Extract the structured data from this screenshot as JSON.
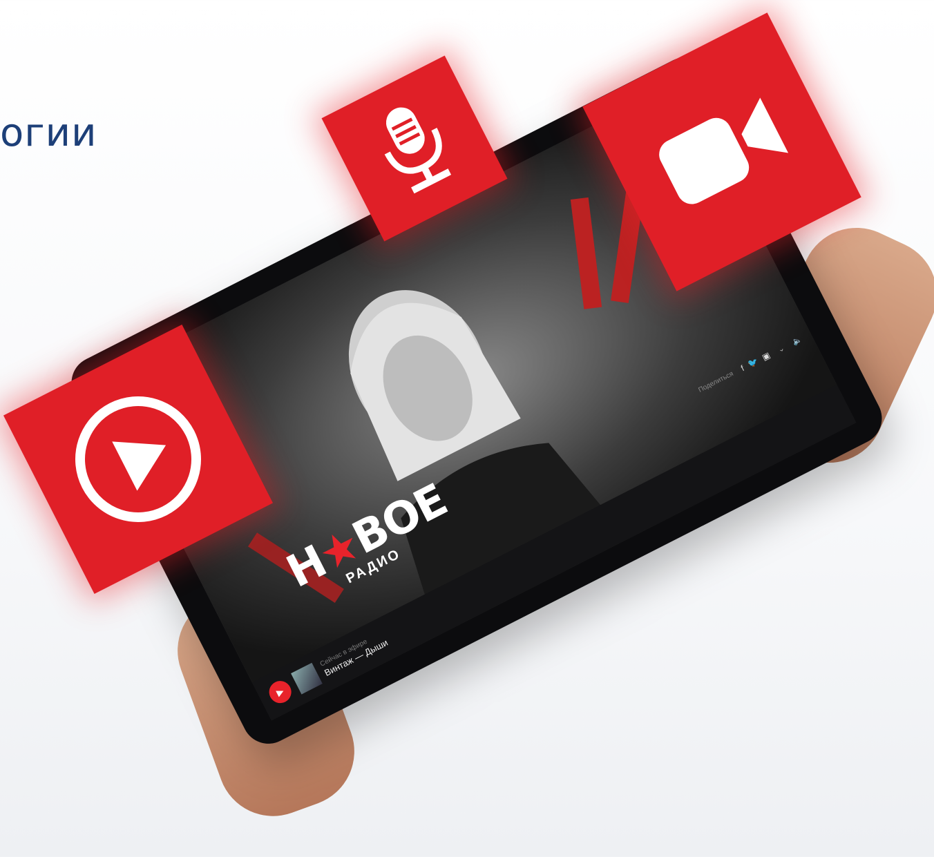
{
  "headline": "огии",
  "logo": {
    "word_start": "Н",
    "word_star": "★",
    "word_end": "ВОЕ",
    "sub": "РАДИО"
  },
  "player": {
    "now_label": "Сейчас в эфире",
    "track": "Винтаж — Дыши",
    "share_label": "Поделиться",
    "share_icons": [
      "facebook-icon",
      "twitter-icon",
      "youtube-icon"
    ]
  },
  "colors": {
    "accent": "#e01f27",
    "headline": "#1d3f78",
    "device": "#0c0c0e"
  }
}
